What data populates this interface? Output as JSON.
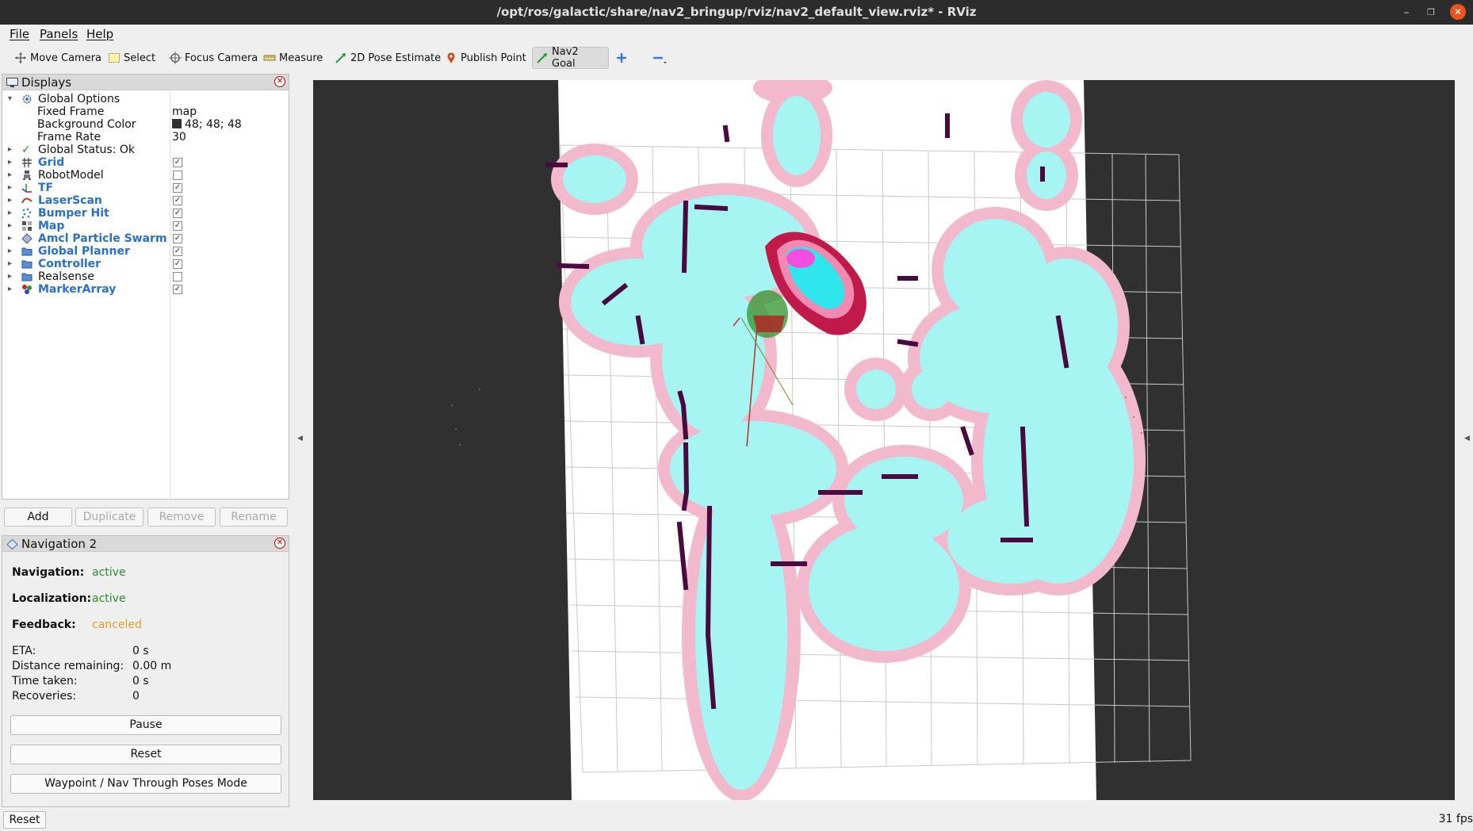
{
  "window": {
    "title": "/opt/ros/galactic/share/nav2_bringup/rviz/nav2_default_view.rviz* - RViz"
  },
  "menu": [
    "File",
    "Panels",
    "Help"
  ],
  "toolbar": {
    "tools": [
      "Move Camera",
      "Select",
      "Focus Camera",
      "Measure",
      "2D Pose Estimate",
      "Publish Point",
      "Nav2 Goal"
    ],
    "active_tool": "Nav2 Goal"
  },
  "displays": {
    "title": "Displays",
    "global_options": {
      "label": "Global Options",
      "fixed_frame_label": "Fixed Frame",
      "fixed_frame_value": "map",
      "background_color_label": "Background Color",
      "background_color_value": "48; 48; 48",
      "frame_rate_label": "Frame Rate",
      "frame_rate_value": "30"
    },
    "global_status": "Global Status: Ok",
    "items": [
      {
        "label": "Grid",
        "checked": true,
        "icon": "grid-icon"
      },
      {
        "label": "RobotModel",
        "checked": false,
        "icon": "robot-icon"
      },
      {
        "label": "TF",
        "checked": true,
        "icon": "axes-icon"
      },
      {
        "label": "LaserScan",
        "checked": true,
        "icon": "laser-icon"
      },
      {
        "label": "Bumper Hit",
        "checked": true,
        "icon": "points-icon"
      },
      {
        "label": "Map",
        "checked": true,
        "icon": "map-icon"
      },
      {
        "label": "Amcl Particle Swarm",
        "checked": true,
        "icon": "pose-array-icon"
      },
      {
        "label": "Global Planner",
        "checked": true,
        "icon": "folder-icon"
      },
      {
        "label": "Controller",
        "checked": true,
        "icon": "folder-icon"
      },
      {
        "label": "Realsense",
        "checked": false,
        "icon": "folder-icon"
      },
      {
        "label": "MarkerArray",
        "checked": true,
        "icon": "marker-icon"
      }
    ],
    "buttons": {
      "add": "Add",
      "duplicate": "Duplicate",
      "remove": "Remove",
      "rename": "Rename"
    }
  },
  "navigation": {
    "title": "Navigation 2",
    "navigation_label": "Navigation:",
    "navigation_value": "active",
    "localization_label": "Localization:",
    "localization_value": "active",
    "feedback_label": "Feedback:",
    "feedback_value": "canceled",
    "eta_label": "ETA:",
    "eta_value": "0 s",
    "distance_label": "Distance remaining:",
    "distance_value": "0.00 m",
    "time_label": "Time taken:",
    "time_value": "0 s",
    "recoveries_label": "Recoveries:",
    "recoveries_value": "0",
    "pause_button": "Pause",
    "reset_button": "Reset",
    "waypoint_button": "Waypoint / Nav Through Poses Mode"
  },
  "colors": {
    "viewport_background": "#303030",
    "status_active": "#2a8c2a",
    "status_canceled": "#e0a020",
    "display_label_blue": "#2a6fc9"
  },
  "statusbar": {
    "reset": "Reset",
    "fps": "31 fps"
  }
}
